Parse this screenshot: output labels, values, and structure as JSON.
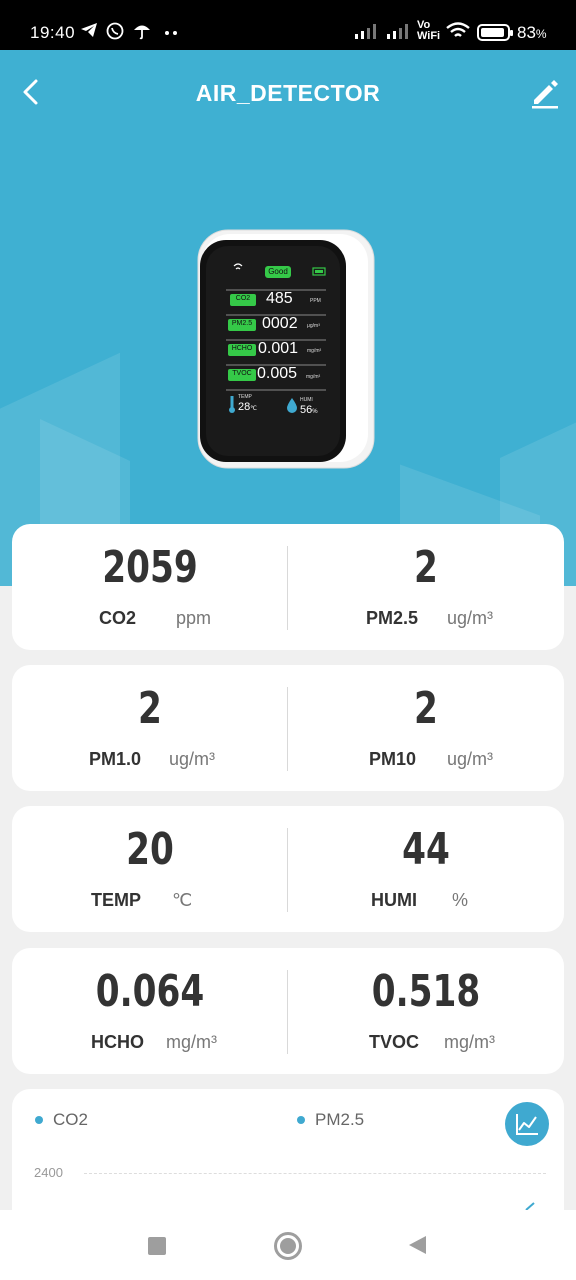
{
  "status_bar": {
    "time": "19:40",
    "battery": "83",
    "battery_unit": "%",
    "network": "Vo WiFi"
  },
  "header": {
    "title": "AIR_DETECTOR"
  },
  "device_image": {
    "status_label": "Good",
    "rows": [
      {
        "label": "CO2",
        "value": "485",
        "unit": "PPM"
      },
      {
        "label": "PM2.5",
        "value": "0002",
        "unit": "μg/m³"
      },
      {
        "label": "HCHO",
        "value": "0.001",
        "unit": "mg/m³"
      },
      {
        "label": "TVOC",
        "value": "0.005",
        "unit": "mg/m³"
      }
    ],
    "temp_label": "TEMP",
    "temp_value": "28",
    "temp_unit": "℃",
    "humi_label": "HUMI",
    "humi_value": "56",
    "humi_unit": "%"
  },
  "readings": [
    {
      "left": {
        "value": "2059",
        "label": "CO2",
        "unit": "ppm"
      },
      "right": {
        "value": "2",
        "label": "PM2.5",
        "unit": "ug/m³"
      }
    },
    {
      "left": {
        "value": "2",
        "label": "PM1.0",
        "unit": "ug/m³"
      },
      "right": {
        "value": "2",
        "label": "PM10",
        "unit": "ug/m³"
      }
    },
    {
      "left": {
        "value": "20",
        "label": "TEMP",
        "unit": "℃"
      },
      "right": {
        "value": "44",
        "label": "HUMI",
        "unit": "%"
      }
    },
    {
      "left": {
        "value": "0.064",
        "label": "HCHO",
        "unit": "mg/m³"
      },
      "right": {
        "value": "0.518",
        "label": "TVOC",
        "unit": "mg/m³"
      }
    }
  ],
  "chart": {
    "legend": [
      "CO2",
      "PM2.5"
    ],
    "y_tick": "2400",
    "accent_color": "#3fa9d0"
  },
  "colors": {
    "header_bg": "#3fb0d2",
    "accent": "#3fa9d0",
    "device_green": "#35c948"
  }
}
